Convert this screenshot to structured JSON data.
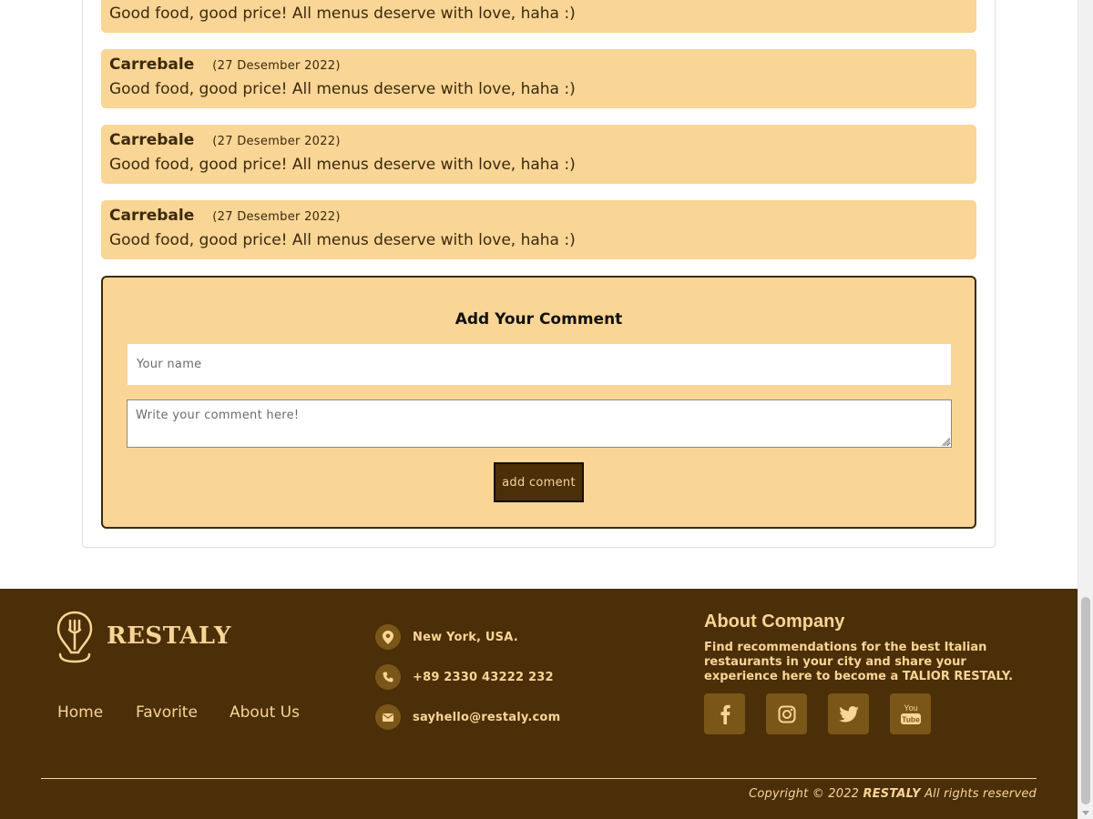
{
  "comments": [
    {
      "author": "",
      "date": "",
      "text": "Good food, good price! All menus deserve with love, haha :)"
    },
    {
      "author": "Carrebale",
      "date": "(27 Desember 2022)",
      "text": "Good food, good price! All menus deserve with love, haha :)"
    },
    {
      "author": "Carrebale",
      "date": "(27 Desember 2022)",
      "text": "Good food, good price! All menus deserve with love, haha :)"
    },
    {
      "author": "Carrebale",
      "date": "(27 Desember 2022)",
      "text": "Good food, good price! All menus deserve with love, haha :)"
    }
  ],
  "comment_form": {
    "title": "Add Your Comment",
    "name_placeholder": "Your name",
    "comment_placeholder": "Write your comment here!",
    "submit_label": "add coment"
  },
  "footer": {
    "brand": "RESTALY",
    "nav": {
      "home": "Home",
      "favorite": "Favorite",
      "about": "About Us"
    },
    "contact": {
      "location": "New York, USA.",
      "phone": "+89 2330 43222 232",
      "email": "sayhello@restaly.com"
    },
    "about_title": "About Company",
    "about_text": "Find recommendations for the best Italian restaurants in your city and share your experience here to become a TALIOR RESTALY.",
    "social_icons": [
      "facebook-icon",
      "instagram-icon",
      "twitter-icon",
      "youtube-icon"
    ],
    "copyright_prefix": "Copyright © 2022",
    "copyright_brand": "RESTALY",
    "copyright_suffix": "All rights reserved"
  },
  "colors": {
    "comment_bg": "#f9d596",
    "footer_bg": "#4a2f08",
    "accent": "#f9d596",
    "icon_bg": "#7a5618"
  }
}
